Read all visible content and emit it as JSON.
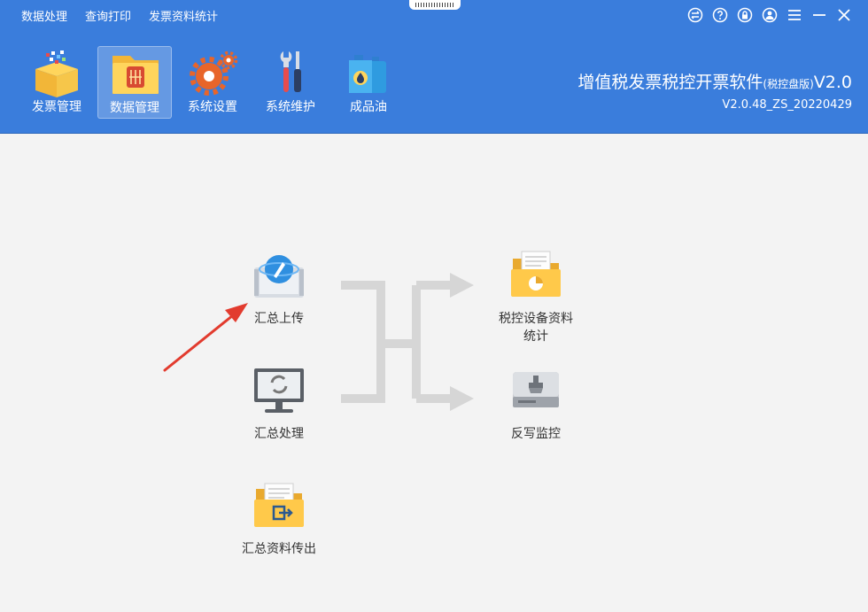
{
  "menubar": {
    "items": [
      {
        "label": "数据处理"
      },
      {
        "label": "查询打印"
      },
      {
        "label": "发票资料统计"
      }
    ]
  },
  "window_controls": [
    "swap-icon",
    "help-icon",
    "lock-icon",
    "user-icon",
    "menu-icon",
    "minimize-icon",
    "close-icon"
  ],
  "toolbar": {
    "items": [
      {
        "label": "发票管理",
        "icon": "invoice-box-icon",
        "active": false
      },
      {
        "label": "数据管理",
        "icon": "data-folder-icon",
        "active": true
      },
      {
        "label": "系统设置",
        "icon": "gears-icon",
        "active": false
      },
      {
        "label": "系统维护",
        "icon": "tools-icon",
        "active": false
      },
      {
        "label": "成品油",
        "icon": "oil-can-icon",
        "active": false
      }
    ]
  },
  "brand": {
    "title": "增值税发票税控开票软件",
    "edition": "(税控盘版)",
    "ver": "V2.0",
    "version": "V2.0.48_ZS_20220429"
  },
  "main": {
    "summary_upload": {
      "label": "汇总上传"
    },
    "summary_process": {
      "label": "汇总处理"
    },
    "summary_export": {
      "label": "汇总资料传出"
    },
    "device_stats": {
      "label_line1": "税控设备资料",
      "label_line2": "统计"
    },
    "writeback_monitor": {
      "label": "反写监控"
    }
  },
  "colors": {
    "header_bg": "#3a7ddc",
    "content_bg": "#f3f3f3",
    "annotation_arrow": "#e23b2e",
    "flow_line": "#d6d6d6"
  }
}
